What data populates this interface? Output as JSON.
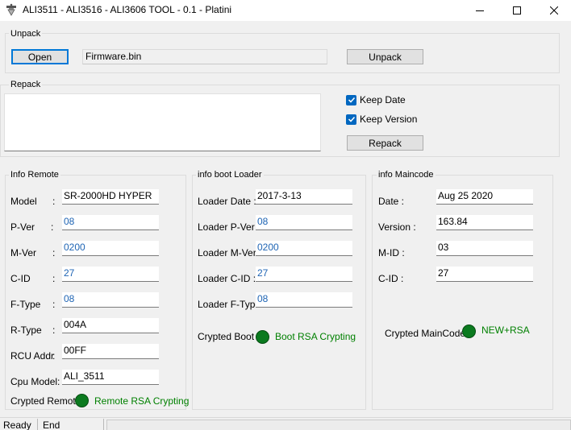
{
  "window": {
    "title": "ALI3511 - ALI3516 - ALI3606  TOOL - 0.1  - Platini",
    "icon": "tool-app-icon"
  },
  "unpack": {
    "group_label": "Unpack",
    "open_label": "Open",
    "file_value": "Firmware.bin",
    "unpack_label": "Unpack"
  },
  "repack": {
    "group_label": "Repack",
    "keep_date_label": "Keep Date",
    "keep_date_checked": true,
    "keep_version_label": "Keep Version",
    "keep_version_checked": true,
    "repack_label": "Repack"
  },
  "remote": {
    "group_label": "Info Remote",
    "model_label": "Model",
    "model_value": "SR-2000HD HYPER",
    "pver_label": "P-Ver",
    "pver_value": "08",
    "mver_label": "M-Ver",
    "mver_value": "0200",
    "cid_label": "C-ID",
    "cid_value": "27",
    "ftype_label": "F-Type",
    "ftype_value": "08",
    "rtype_label": "R-Type",
    "rtype_value": "004A",
    "rcu_label": "RCU Addr",
    "rcu_value": "00FF",
    "cpu_label": "Cpu Model:",
    "cpu_value": "ALI_3511",
    "crypted_label": "Crypted Remote",
    "crypted_status": "Remote RSA Crypting"
  },
  "boot": {
    "group_label": "info boot Loader",
    "date_label": "Loader Date :",
    "date_value": "2017-3-13",
    "pver_label": "Loader P-Ver :",
    "pver_value": "08",
    "mver_label": "Loader M-Ver :",
    "mver_value": "0200",
    "cid_label": "Loader C-ID  :",
    "cid_value": "27",
    "ftype_label": "Loader F-Type:",
    "ftype_value": "08",
    "crypted_label": "Crypted Boot",
    "crypted_status": "Boot RSA Crypting"
  },
  "main": {
    "group_label": "info Maincode",
    "date_label": "Date :",
    "date_value": "Aug 25 2020",
    "version_label": "Version :",
    "version_value": "163.84",
    "mid_label": "M-ID   :",
    "mid_value": "03",
    "cid_label": "C-ID  :",
    "cid_value": "27",
    "crypted_label": "Crypted MainCode",
    "crypted_status": "NEW+RSA"
  },
  "statusbar": {
    "panel1": "Ready",
    "panel2": "End"
  },
  "colors": {
    "status_green": "#008000",
    "led_green": "#0b7a1f",
    "value_blue": "#1e64b4",
    "checkbox_blue": "#0067c0"
  }
}
